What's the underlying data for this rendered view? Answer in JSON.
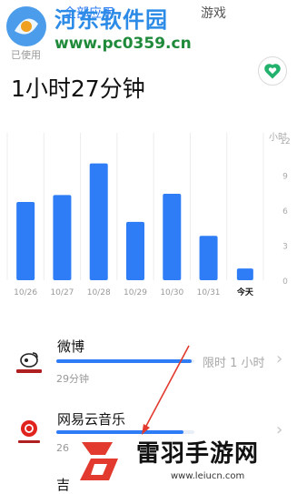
{
  "tabs": [
    {
      "label": "全部应用",
      "active": true
    },
    {
      "label": "游戏",
      "active": false
    }
  ],
  "watermark_top": {
    "title": "河东软件园",
    "url": "www.pc0359.cn"
  },
  "summary": {
    "used_label": "已使用",
    "total_time": "1小时27分钟"
  },
  "favorite_icon": "heart-icon",
  "chart_data": {
    "type": "bar",
    "categories": [
      "10/26",
      "10/27",
      "10/28",
      "10/29",
      "10/30",
      "10/31",
      "今天"
    ],
    "values": [
      6.7,
      7.3,
      10,
      5,
      7.4,
      3.8,
      1
    ],
    "ylabel": "小时",
    "yticks": [
      0,
      3,
      6,
      9,
      12
    ],
    "ylim": [
      0,
      12
    ],
    "highlight_today": true,
    "bar_color": "#2f7df6"
  },
  "apps": [
    {
      "name": "微博",
      "duration": "29分钟",
      "limit": "限时 1 小时",
      "usage_fraction": 0.98
    },
    {
      "name": "网易云音乐",
      "duration": "26",
      "limit": "",
      "usage_fraction": 0.92
    }
  ],
  "partial_app_name": "吉",
  "watermark_bottom": {
    "name": "雷羽手游网",
    "url": "www.leiucn.com"
  },
  "colors": {
    "accent": "#2f7df6",
    "watermark_blue": "#2b8be6",
    "watermark_green": "#1e8a3a",
    "heart_green": "#23b26d",
    "arrow_red": "#e23a2e"
  }
}
